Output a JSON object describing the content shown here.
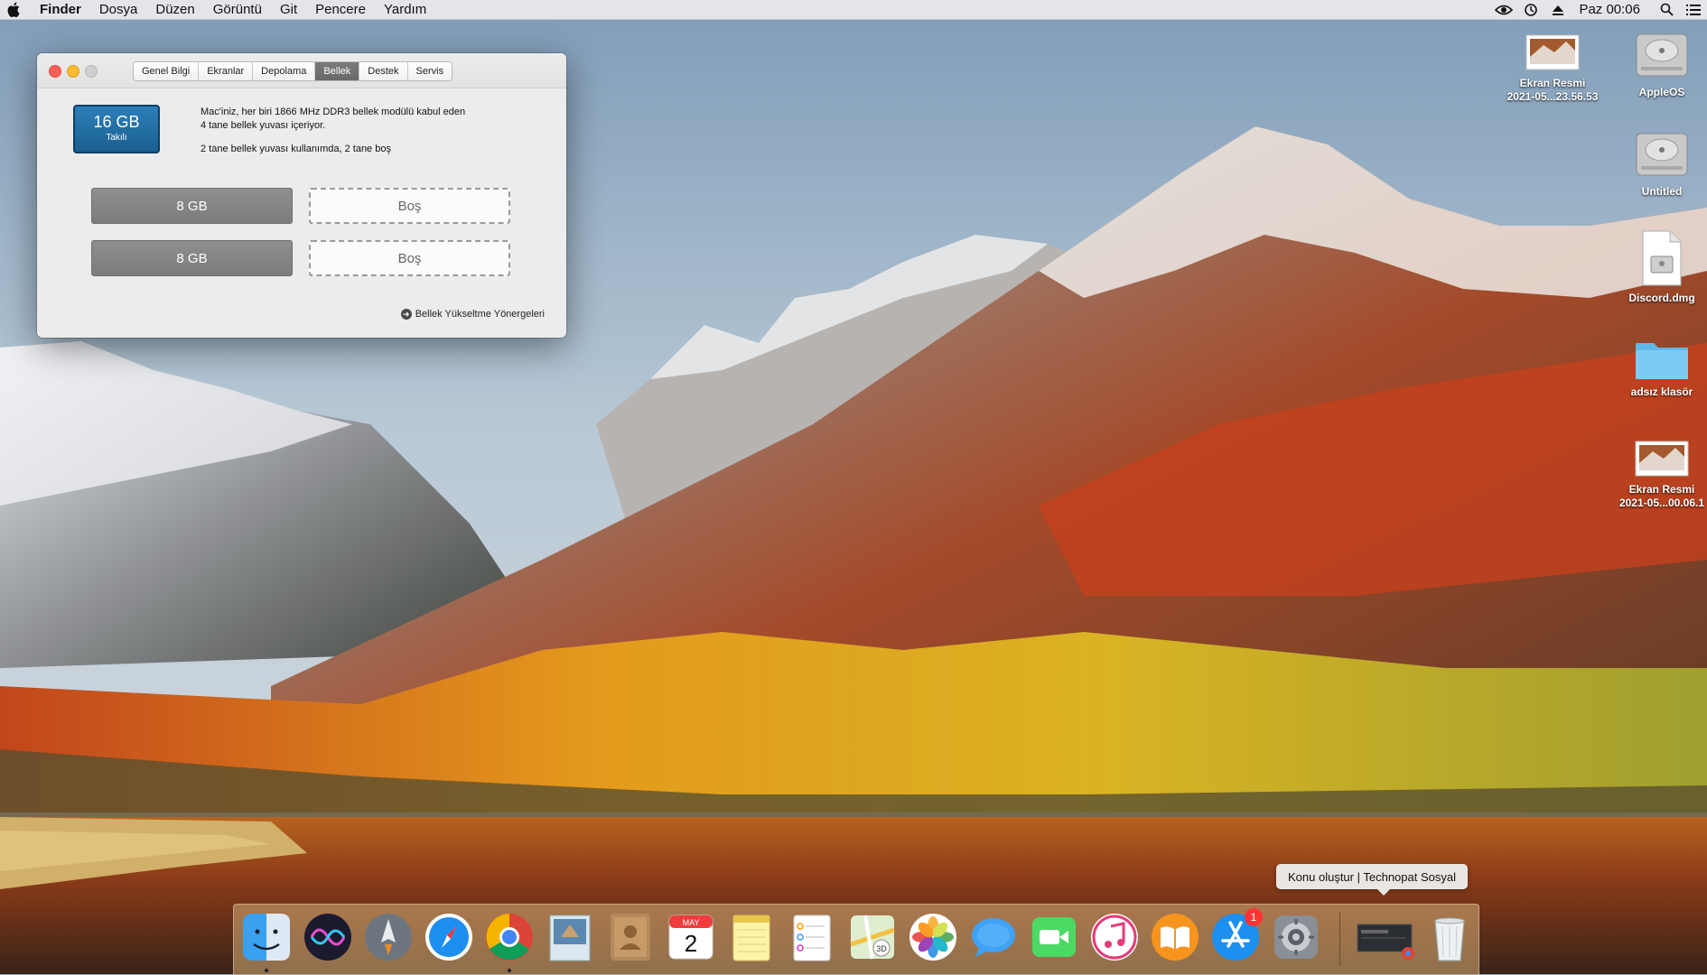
{
  "menubar": {
    "app": "Finder",
    "items": [
      "Dosya",
      "Düzen",
      "Görüntü",
      "Git",
      "Pencere",
      "Yardım"
    ],
    "clock": "Paz 00:06",
    "status_icons": [
      "nvidia-icon",
      "time-machine-icon",
      "eject-icon",
      "search-icon",
      "list-icon"
    ]
  },
  "window": {
    "tabs": [
      "Genel Bilgi",
      "Ekranlar",
      "Depolama",
      "Bellek",
      "Destek",
      "Servis"
    ],
    "active_tab": "Bellek",
    "badge_size": "16 GB",
    "badge_sub": "Takılı",
    "desc_line1": "Mac'iniz, her biri 1866 MHz DDR3 bellek modülü kabul eden",
    "desc_line2": "4 tane bellek yuvası içeriyor.",
    "desc_line3": "2 tane bellek yuvası kullanımda, 2 tane boş",
    "slots": [
      {
        "label": "8 GB",
        "state": "full"
      },
      {
        "label": "Boş",
        "state": "empty"
      },
      {
        "label": "8 GB",
        "state": "full"
      },
      {
        "label": "Boş",
        "state": "empty"
      }
    ],
    "guide_link": "Bellek Yükseltme Yönergeleri"
  },
  "desktop": {
    "icons": [
      {
        "label1": "Ekran Resmi",
        "label2": "2021-05...23.56.53",
        "type": "screenshot"
      },
      {
        "label1": "AppleOS",
        "label2": "",
        "type": "disk"
      },
      {
        "label1": "Untitled",
        "label2": "",
        "type": "disk"
      },
      {
        "label1": "Discord.dmg",
        "label2": "",
        "type": "dmg"
      },
      {
        "label1": "adsız klasör",
        "label2": "",
        "type": "folder"
      },
      {
        "label1": "Ekran Resmi",
        "label2": "2021-05...00.06.1",
        "type": "screenshot"
      }
    ]
  },
  "dock": {
    "apps": [
      "finder-icon",
      "siri-icon",
      "launchpad-icon",
      "safari-icon",
      "chrome-icon",
      "mail-icon",
      "contacts-icon",
      "calendar-icon",
      "notes-icon",
      "reminders-icon",
      "maps-icon",
      "photos-icon",
      "messages-icon",
      "facetime-icon",
      "itunes-icon",
      "ibooks-icon",
      "app-store-icon",
      "system-preferences-icon"
    ],
    "calendar_month": "MAY",
    "calendar_day": "2",
    "app_store_badge": "1",
    "tooltip": "Konu oluştur | Technopat Sosyal"
  }
}
